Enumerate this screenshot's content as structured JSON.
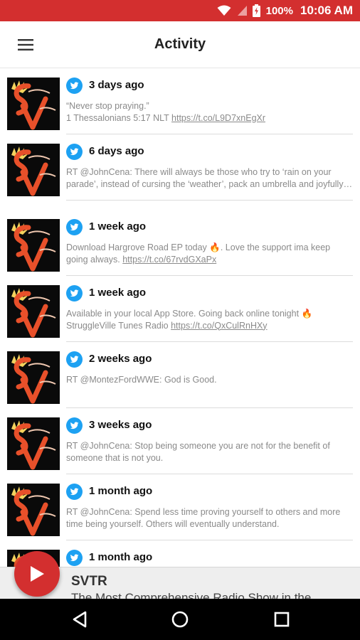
{
  "status_bar": {
    "battery_percent": "100%",
    "time": "10:06 AM",
    "icons": [
      "wifi-icon",
      "signal-icon",
      "battery-charging-icon"
    ]
  },
  "app_bar": {
    "title": "Activity",
    "menu_icon": "hamburger-menu-icon"
  },
  "feed": {
    "items": [
      {
        "time": "3 days ago",
        "text_before": "“Never stop praying.”\n1 Thessalonians 5:17 NLT ",
        "link": "https://t.co/L9D7xnEgXr",
        "text_after": ""
      },
      {
        "time": "6 days ago",
        "text_before": "RT @JohnCena: There will always be those who try to ‘rain on your parade’, instead of cursing the ‘weather’, pack an umbrella and joyfully…",
        "link": "",
        "text_after": ""
      },
      {
        "time": "1 week ago",
        "text_before": "Download Hargrove Road EP today 🔥. Love the support ima keep going always. ",
        "link": "https://t.co/67rvdGXaPx",
        "text_after": ""
      },
      {
        "time": "1 week ago",
        "text_before": "Available in your local App Store. Going back online tonight 🔥\nStruggleVille Tunes Radio ",
        "link": "https://t.co/QxCulRnHXy",
        "text_after": ""
      },
      {
        "time": "2 weeks ago",
        "text_before": "RT @MontezFordWWE: God is Good.",
        "link": "",
        "text_after": ""
      },
      {
        "time": "3 weeks ago",
        "text_before": "RT @JohnCena: Stop being someone you are not for the benefit of someone that is not you.",
        "link": "",
        "text_after": ""
      },
      {
        "time": "1 month ago",
        "text_before": "RT @JohnCena: Spend less time proving yourself to others and more time being yourself. Others will eventually understand.",
        "link": "",
        "text_after": ""
      },
      {
        "time": "1 month ago",
        "text_before": "",
        "link": "",
        "text_after": ""
      }
    ]
  },
  "player": {
    "title": "SVTR",
    "subtitle": "The Most Comprehensive Radio Show in the"
  },
  "nav": {
    "icons": [
      "back-icon",
      "home-icon",
      "recents-icon"
    ]
  },
  "colors": {
    "accent": "#d32f2f",
    "twitter": "#1da1f2",
    "logo_bg": "#0a0a0a"
  }
}
